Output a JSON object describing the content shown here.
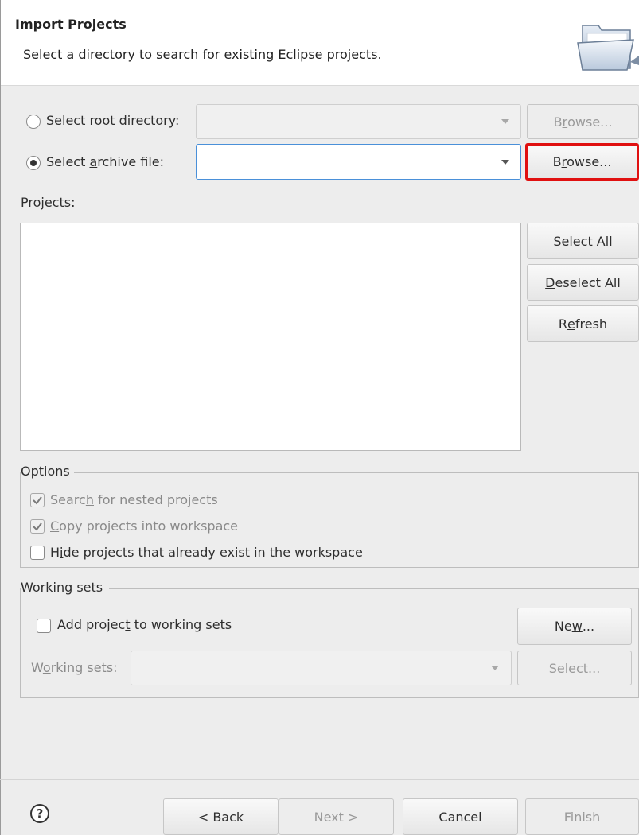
{
  "header": {
    "title": "Import Projects",
    "subtitle": "Select a directory to search for existing Eclipse projects.",
    "banner_icon": "folder-open-icon"
  },
  "source": {
    "root_directory": {
      "label_pre": "Select roo",
      "label_mnemonic": "t",
      "label_post": " directory:",
      "selected": false,
      "value": "",
      "browse_pre": "B",
      "browse_mnemonic": "r",
      "browse_post": "owse..."
    },
    "archive_file": {
      "label_pre": "Select ",
      "label_mnemonic": "a",
      "label_post": "rchive file:",
      "selected": true,
      "value": "",
      "browse_pre": "B",
      "browse_mnemonic": "r",
      "browse_post": "owse..."
    }
  },
  "projects": {
    "label_mnemonic": "P",
    "label_post": "rojects:",
    "items": [],
    "select_all_mnemonic": "S",
    "select_all_post": "elect All",
    "deselect_all_mnemonic": "D",
    "deselect_all_post": "eselect All",
    "refresh_pre": "R",
    "refresh_mnemonic": "e",
    "refresh_post": "fresh"
  },
  "options": {
    "title": "Options",
    "nested": {
      "pre": "Searc",
      "mnemonic": "h",
      "post": " for nested projects",
      "checked": true,
      "enabled": false
    },
    "copy": {
      "pre": "",
      "mnemonic": "C",
      "post": "opy projects into workspace",
      "checked": true,
      "enabled": false
    },
    "hide": {
      "pre": "H",
      "mnemonic": "i",
      "post": "de projects that already exist in the workspace",
      "checked": false,
      "enabled": true
    }
  },
  "working_sets": {
    "title": "Working sets",
    "add": {
      "pre": "Add projec",
      "mnemonic": "t",
      "post": " to working sets",
      "checked": false
    },
    "new_pre": "Ne",
    "new_mnemonic": "w",
    "new_post": "...",
    "sets_pre": "W",
    "sets_mnemonic": "o",
    "sets_post": "rking sets:",
    "sets_value": "",
    "select_pre": "S",
    "select_mnemonic": "e",
    "select_post": "lect..."
  },
  "footer": {
    "help_icon": "help-icon",
    "help_glyph": "?",
    "back": "< Back",
    "next": "Next >",
    "cancel": "Cancel",
    "finish": "Finish"
  },
  "colors": {
    "highlight": "#e01010",
    "focus": "#4a90d9"
  }
}
